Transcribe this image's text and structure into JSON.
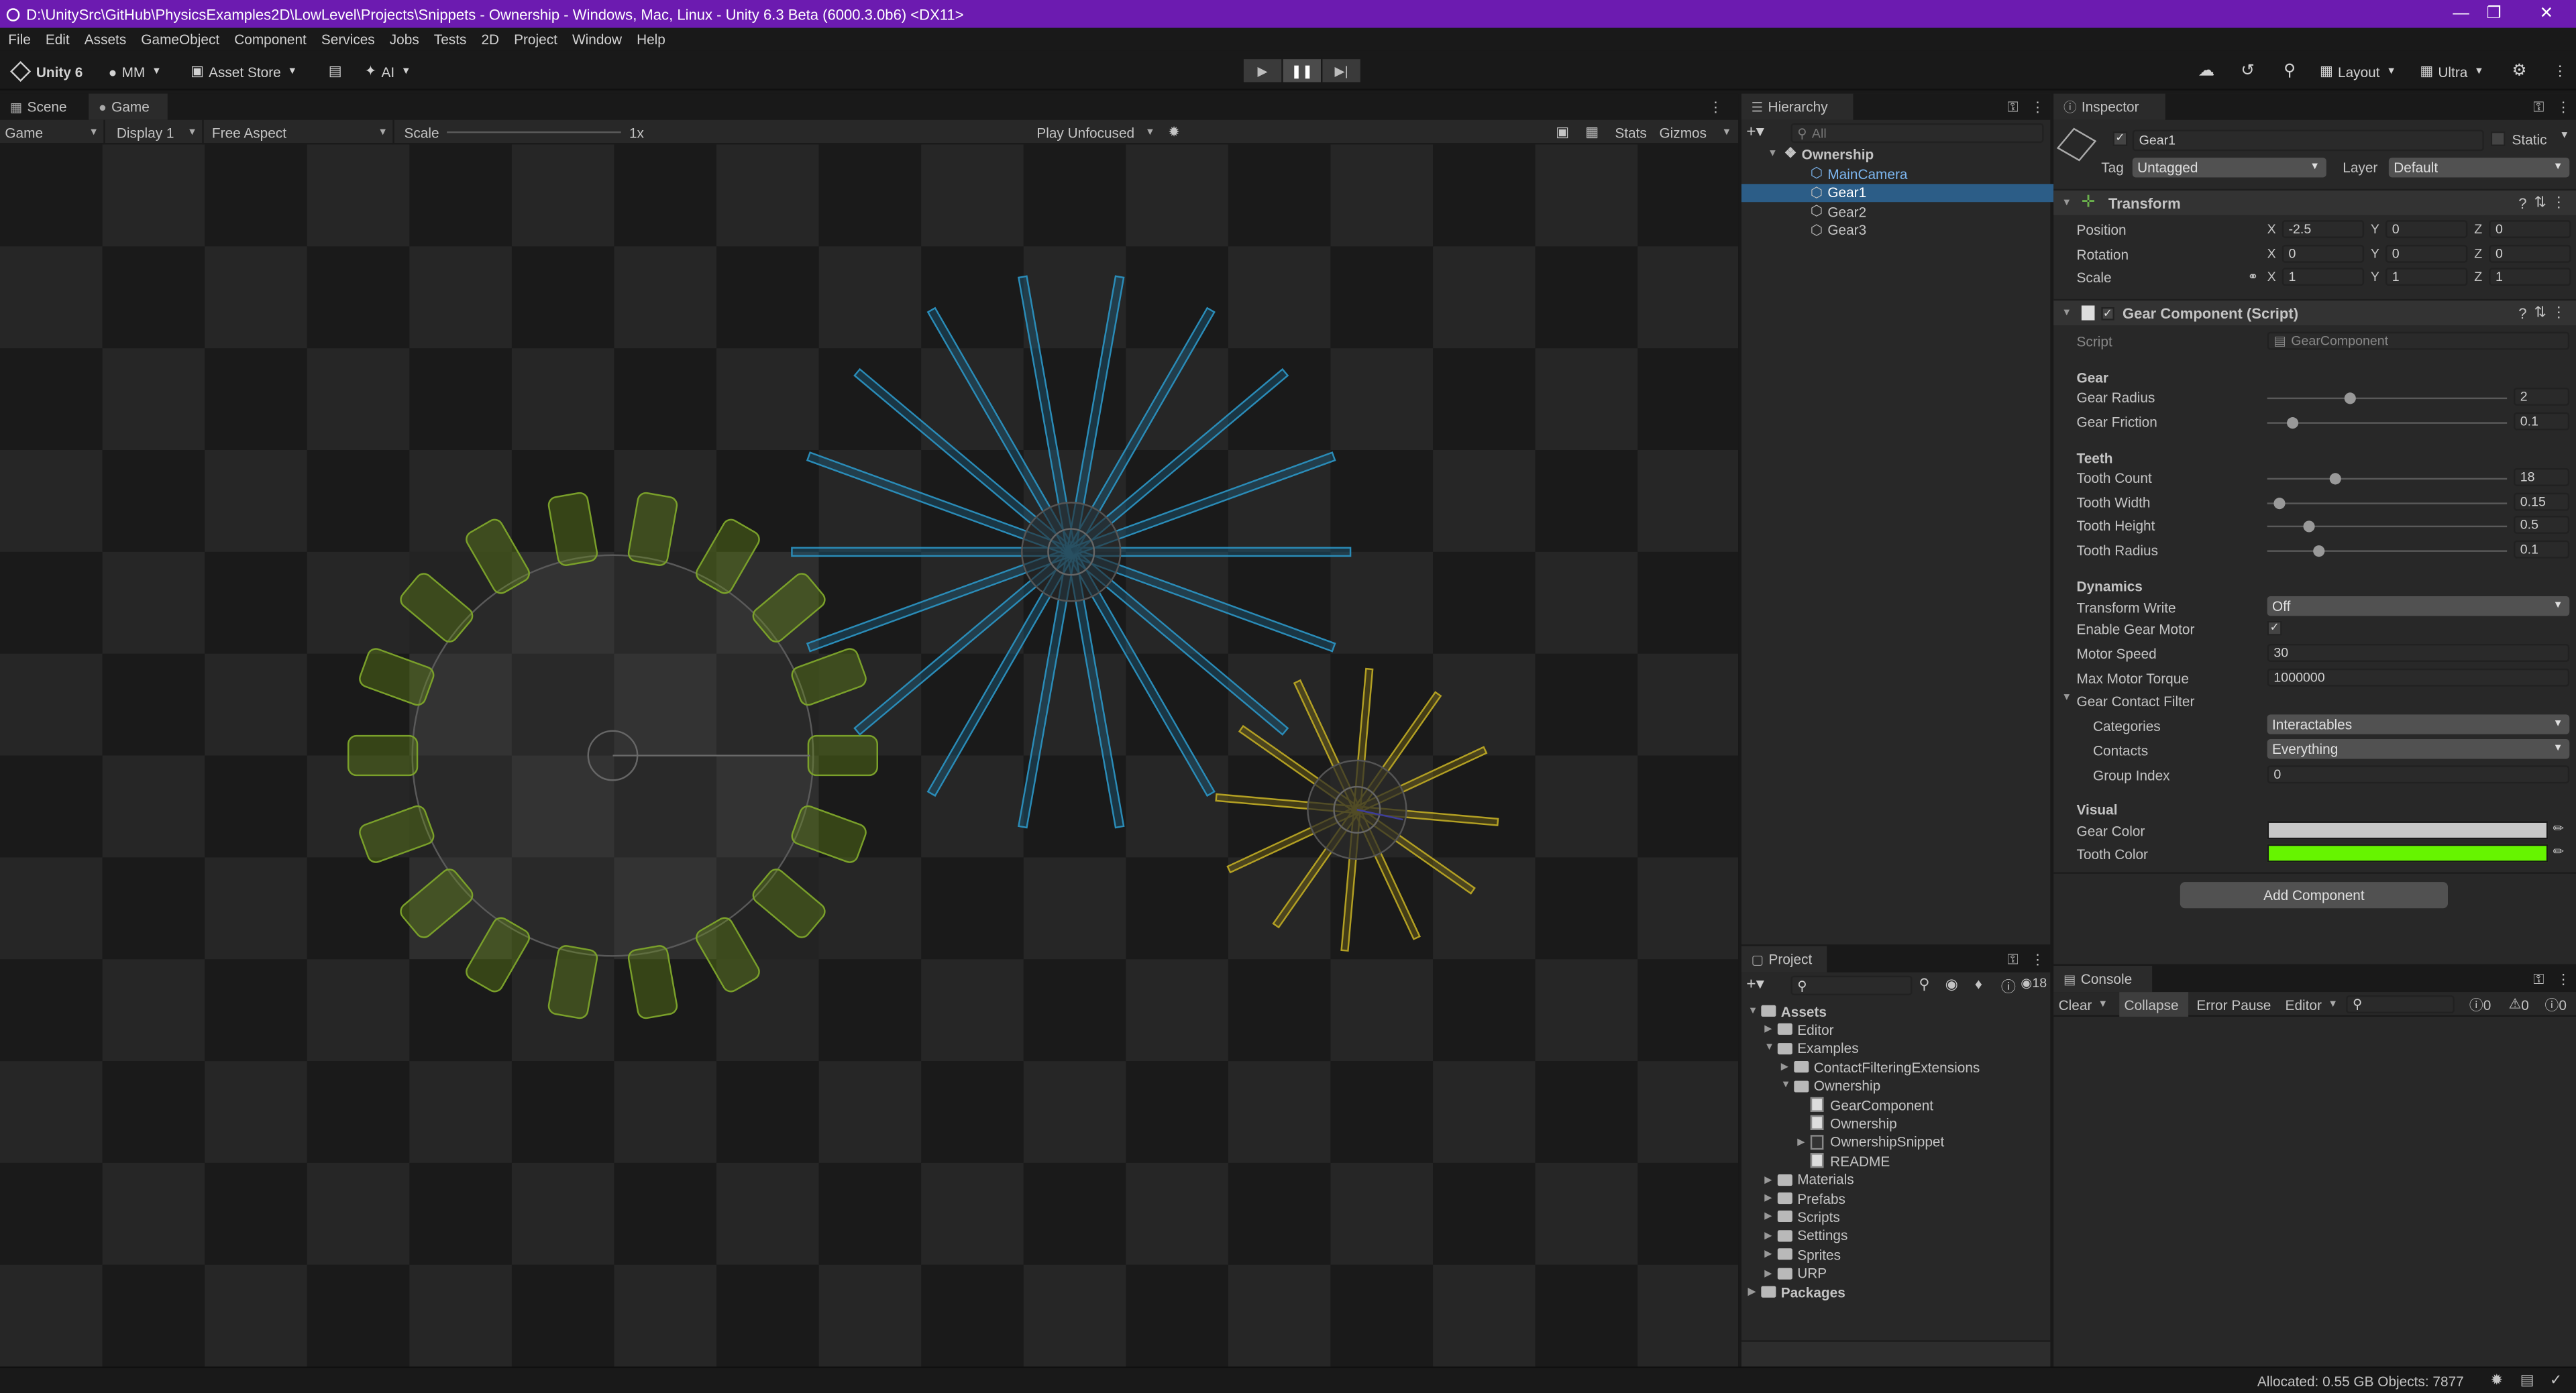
{
  "window": {
    "title": "D:\\UnitySrc\\GitHub\\PhysicsExamples2D\\LowLevel\\Projects\\Snippets - Ownership - Windows, Mac, Linux - Unity 6.3 Beta (6000.3.0b6) <DX11>"
  },
  "menu": [
    "File",
    "Edit",
    "Assets",
    "GameObject",
    "Component",
    "Services",
    "Jobs",
    "Tests",
    "2D",
    "Project",
    "Window",
    "Help"
  ],
  "toolbar": {
    "unity_label": "Unity 6",
    "account": "MM",
    "asset_store": "Asset Store",
    "ai": "AI",
    "layout": "Layout",
    "quality": "Ultra"
  },
  "scene_tabs": {
    "scene": "Scene",
    "game": "Game"
  },
  "game_toolbar": {
    "mode": "Game",
    "display": "Display 1",
    "aspect": "Free Aspect",
    "scale_label": "Scale",
    "scale_value": "1x",
    "play_focus": "Play Unfocused",
    "stats": "Stats",
    "gizmos": "Gizmos"
  },
  "hierarchy": {
    "tab": "Hierarchy",
    "search_placeholder": "All",
    "scene": "Ownership",
    "items": [
      {
        "name": "MainCamera",
        "selected": false
      },
      {
        "name": "Gear1",
        "selected": true
      },
      {
        "name": "Gear2",
        "selected": false
      },
      {
        "name": "Gear3",
        "selected": false
      }
    ]
  },
  "inspector": {
    "tab": "Inspector",
    "object_name": "Gear1",
    "static_label": "Static",
    "tag_label": "Tag",
    "tag_value": "Untagged",
    "layer_label": "Layer",
    "layer_value": "Default",
    "transform": {
      "title": "Transform",
      "position": {
        "label": "Position",
        "x": "-2.5",
        "y": "0",
        "z": "0"
      },
      "rotation": {
        "label": "Rotation",
        "x": "0",
        "y": "0",
        "z": "0"
      },
      "scale": {
        "label": "Scale",
        "x": "1",
        "y": "1",
        "z": "1"
      }
    },
    "gear_component": {
      "title": "Gear Component (Script)",
      "script_label": "Script",
      "script_value": "GearComponent",
      "gear_section": "Gear",
      "gear_radius": {
        "label": "Gear Radius",
        "value": "2",
        "fraction": 0.34
      },
      "gear_friction": {
        "label": "Gear Friction",
        "value": "0.1",
        "fraction": 0.1
      },
      "teeth_section": "Teeth",
      "tooth_count": {
        "label": "Tooth Count",
        "value": "18",
        "fraction": 0.28
      },
      "tooth_width": {
        "label": "Tooth Width",
        "value": "0.15",
        "fraction": 0.05
      },
      "tooth_height": {
        "label": "Tooth Height",
        "value": "0.5",
        "fraction": 0.17
      },
      "tooth_radius": {
        "label": "Tooth Radius",
        "value": "0.1",
        "fraction": 0.21
      },
      "dynamics_section": "Dynamics",
      "transform_write": {
        "label": "Transform Write",
        "value": "Off"
      },
      "enable_gear_motor": {
        "label": "Enable Gear Motor",
        "checked": true
      },
      "motor_speed": {
        "label": "Motor Speed",
        "value": "30"
      },
      "max_motor_torque": {
        "label": "Max Motor Torque",
        "value": "1000000"
      },
      "contact_filter": {
        "label": "Gear Contact Filter",
        "categories_label": "Categories",
        "categories_value": "Interactables",
        "contacts_label": "Contacts",
        "contacts_value": "Everything",
        "group_label": "Group Index",
        "group_value": "0"
      },
      "visual_section": "Visual",
      "gear_color": {
        "label": "Gear Color",
        "color": "#c8c8c8"
      },
      "tooth_color": {
        "label": "Tooth Color",
        "color": "#66f400"
      }
    },
    "add_component": "Add Component"
  },
  "project": {
    "tab": "Project",
    "count": "18",
    "tree": [
      {
        "label": "Assets",
        "depth": 0,
        "open": true,
        "type": "folder",
        "bold": true
      },
      {
        "label": "Editor",
        "depth": 1,
        "open": false,
        "type": "folder"
      },
      {
        "label": "Examples",
        "depth": 1,
        "open": true,
        "type": "folder"
      },
      {
        "label": "ContactFilteringExtensions",
        "depth": 2,
        "open": false,
        "type": "folder"
      },
      {
        "label": "Ownership",
        "depth": 2,
        "open": true,
        "type": "folder"
      },
      {
        "label": "GearComponent",
        "depth": 3,
        "type": "script"
      },
      {
        "label": "Ownership",
        "depth": 3,
        "type": "scene"
      },
      {
        "label": "OwnershipSnippet",
        "depth": 3,
        "open": false,
        "type": "prefab"
      },
      {
        "label": "README",
        "depth": 3,
        "type": "doc"
      },
      {
        "label": "Materials",
        "depth": 1,
        "open": false,
        "type": "folder"
      },
      {
        "label": "Prefabs",
        "depth": 1,
        "open": false,
        "type": "folder"
      },
      {
        "label": "Scripts",
        "depth": 1,
        "open": false,
        "type": "folder"
      },
      {
        "label": "Settings",
        "depth": 1,
        "open": false,
        "type": "folder"
      },
      {
        "label": "Sprites",
        "depth": 1,
        "open": false,
        "type": "folder"
      },
      {
        "label": "URP",
        "depth": 1,
        "open": false,
        "type": "folder"
      },
      {
        "label": "Packages",
        "depth": 0,
        "open": false,
        "type": "folder",
        "bold": true
      }
    ]
  },
  "console": {
    "tab": "Console",
    "clear": "Clear",
    "collapse": "Collapse",
    "error_pause": "Error Pause",
    "editor": "Editor",
    "info_count": "0",
    "warn_count": "0",
    "error_count": "0"
  },
  "status": {
    "text": "Allocated: 0.55 GB Objects: 7877"
  }
}
